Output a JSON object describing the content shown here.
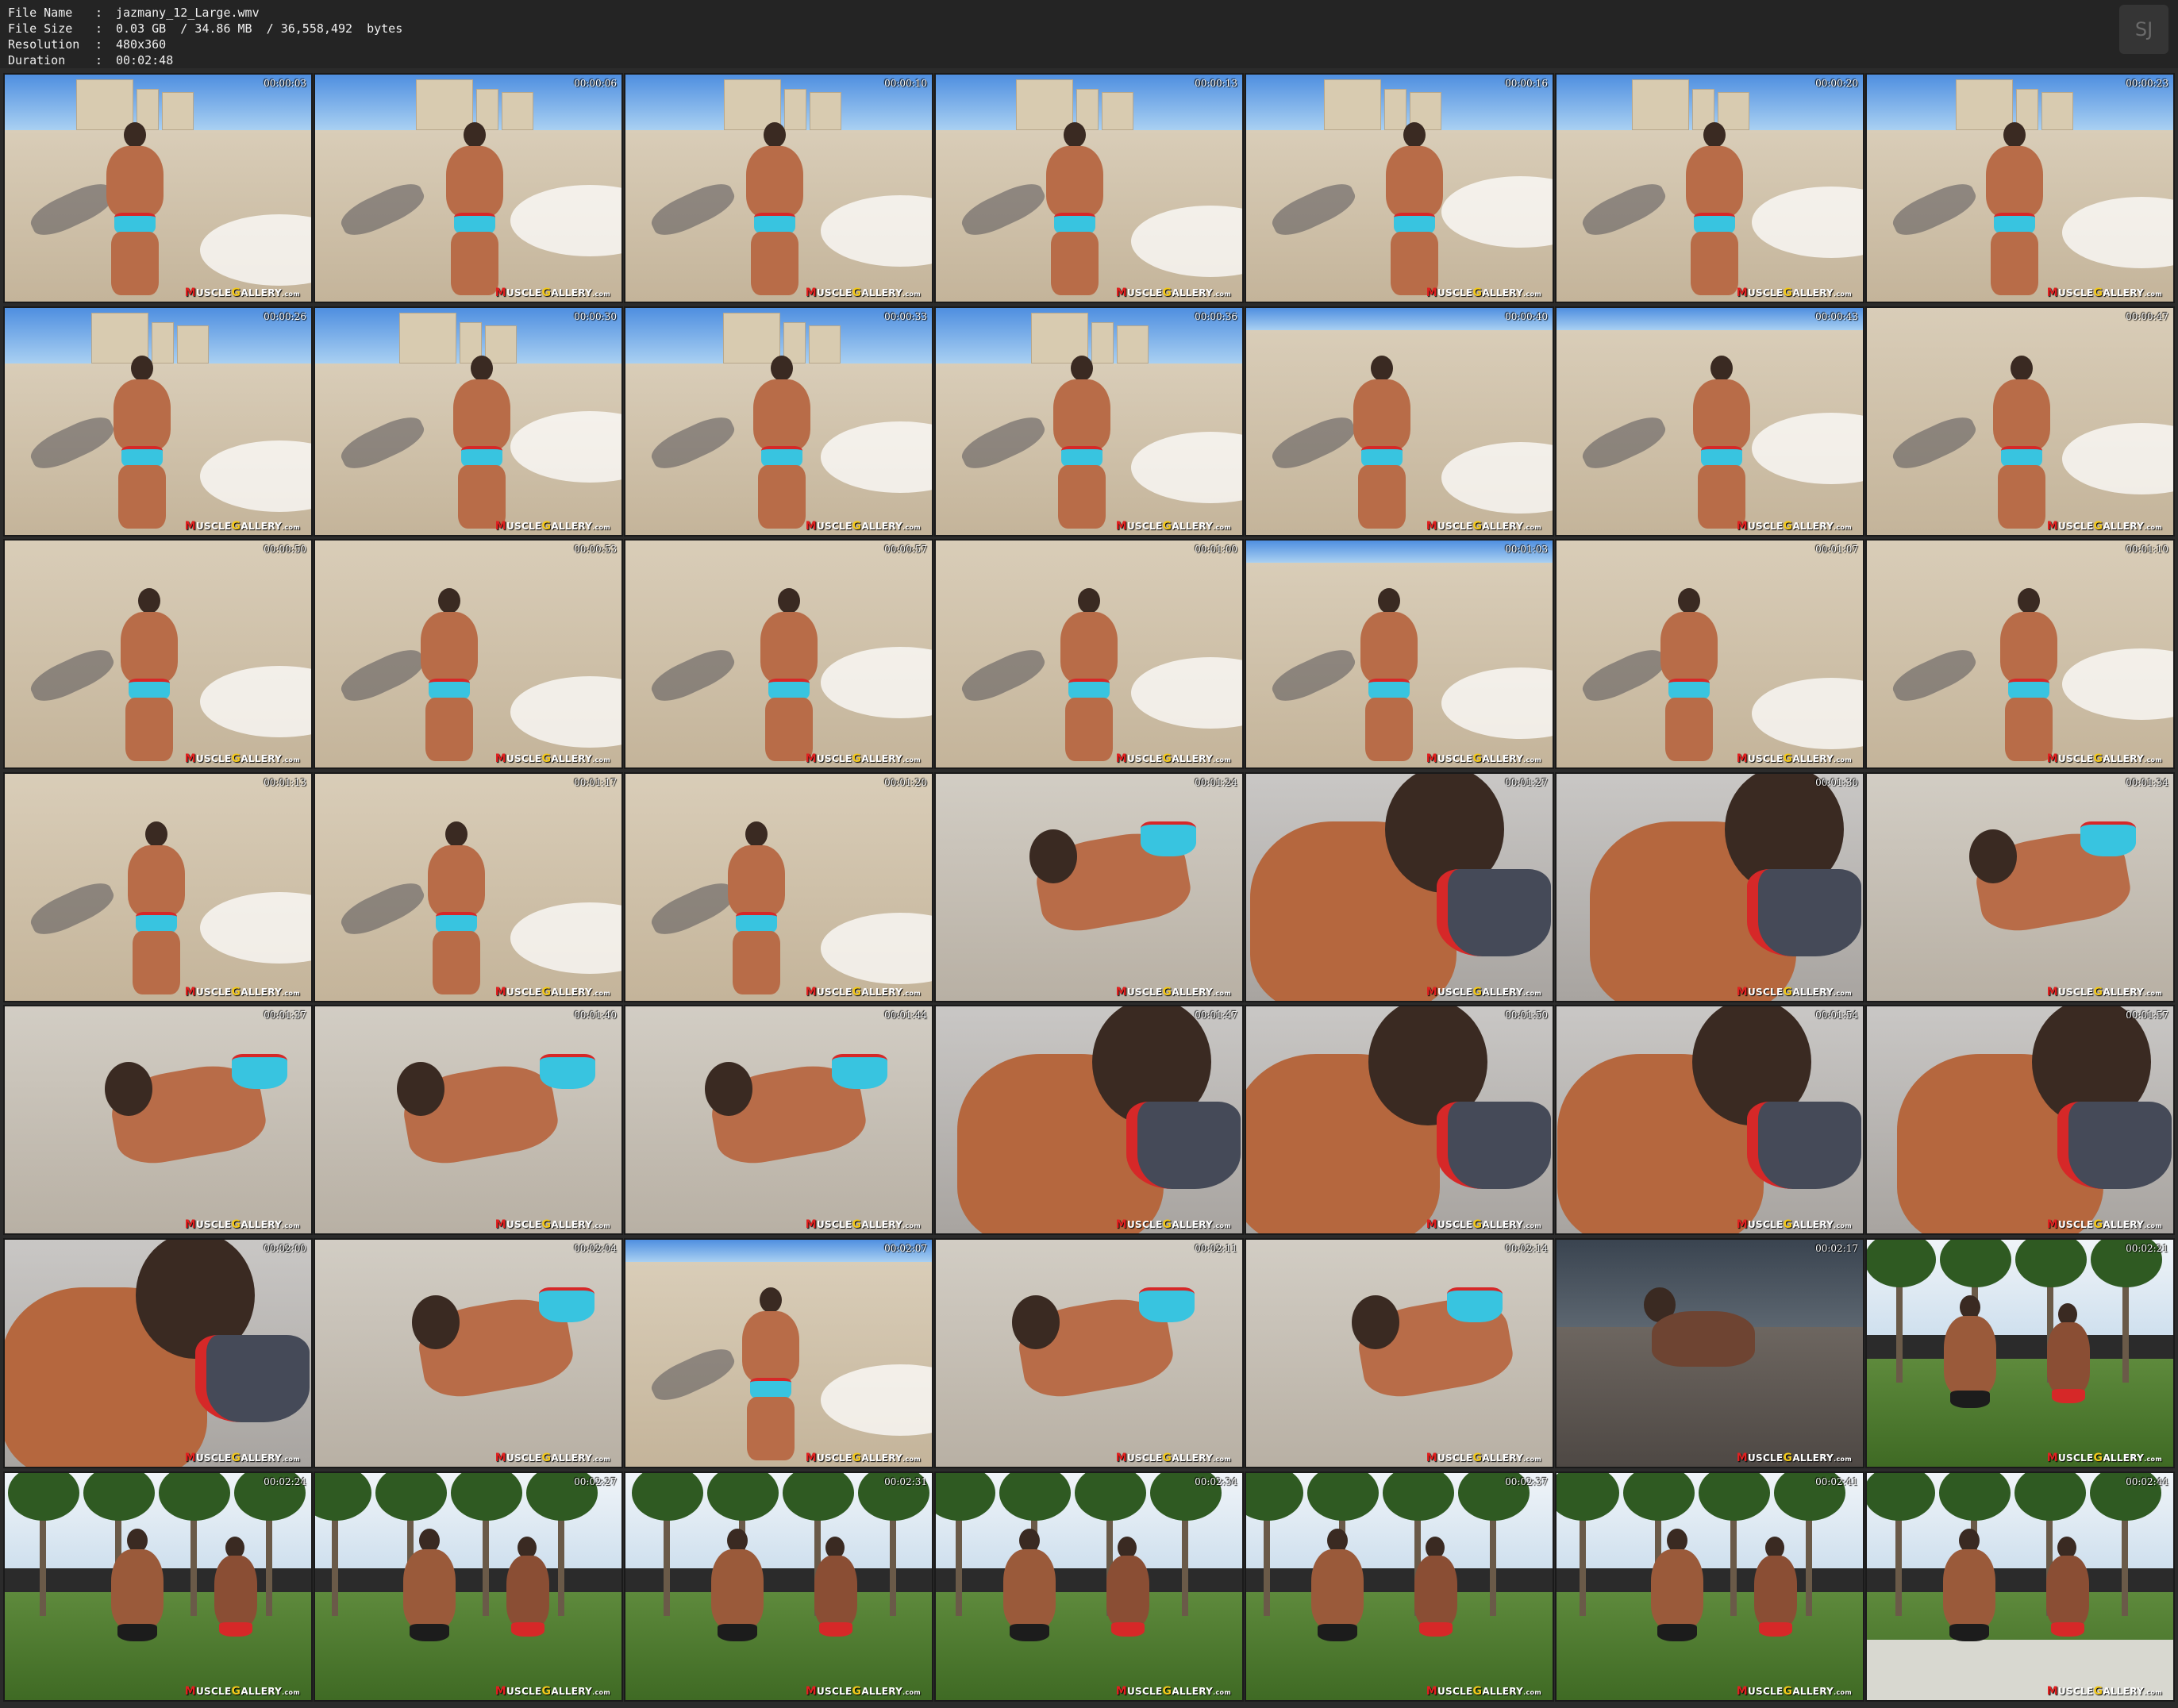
{
  "info": {
    "rows": [
      {
        "key": "File Name",
        "value": "jazmany_12_Large.wmv"
      },
      {
        "key": "File Size",
        "value": "0.03 GB  / 34.86 MB  / 36,558,492  bytes"
      },
      {
        "key": "Resolution",
        "value": "480x360"
      },
      {
        "key": "Duration",
        "value": "00:02:48"
      }
    ],
    "separator": ":"
  },
  "logo_text": "SJ",
  "watermark": {
    "m": "M",
    "uscle": "USCLE",
    "g": "G",
    "allery": "ALLERY",
    "dom": ".com"
  },
  "thumbs": [
    {
      "ts": "00:00:03",
      "scene": "beach-city"
    },
    {
      "ts": "00:00:06",
      "scene": "beach-city"
    },
    {
      "ts": "00:00:10",
      "scene": "beach-city"
    },
    {
      "ts": "00:00:13",
      "scene": "beach-city"
    },
    {
      "ts": "00:00:16",
      "scene": "beach-city"
    },
    {
      "ts": "00:00:20",
      "scene": "beach-city"
    },
    {
      "ts": "00:00:23",
      "scene": "beach-city"
    },
    {
      "ts": "00:00:26",
      "scene": "beach-city"
    },
    {
      "ts": "00:00:30",
      "scene": "beach-city"
    },
    {
      "ts": "00:00:33",
      "scene": "beach-city"
    },
    {
      "ts": "00:00:36",
      "scene": "beach-city"
    },
    {
      "ts": "00:00:40",
      "scene": "beach-water"
    },
    {
      "ts": "00:00:43",
      "scene": "beach-water"
    },
    {
      "ts": "00:00:47",
      "scene": "beach-sand"
    },
    {
      "ts": "00:00:50",
      "scene": "beach-sand"
    },
    {
      "ts": "00:00:53",
      "scene": "beach-sand"
    },
    {
      "ts": "00:00:57",
      "scene": "beach-sand"
    },
    {
      "ts": "00:01:00",
      "scene": "beach-sand"
    },
    {
      "ts": "00:01:03",
      "scene": "beach-water"
    },
    {
      "ts": "00:01:07",
      "scene": "beach-sand"
    },
    {
      "ts": "00:01:10",
      "scene": "beach-sand"
    },
    {
      "ts": "00:01:13",
      "scene": "beach-sand"
    },
    {
      "ts": "00:01:17",
      "scene": "beach-sand"
    },
    {
      "ts": "00:01:20",
      "scene": "beach-sand"
    },
    {
      "ts": "00:01:24",
      "scene": "sand-close"
    },
    {
      "ts": "00:01:27",
      "scene": "closeup"
    },
    {
      "ts": "00:01:30",
      "scene": "closeup"
    },
    {
      "ts": "00:01:34",
      "scene": "sand-close"
    },
    {
      "ts": "00:01:37",
      "scene": "sand-close"
    },
    {
      "ts": "00:01:40",
      "scene": "sand-close"
    },
    {
      "ts": "00:01:44",
      "scene": "sand-close"
    },
    {
      "ts": "00:01:47",
      "scene": "closeup"
    },
    {
      "ts": "00:01:50",
      "scene": "closeup"
    },
    {
      "ts": "00:01:54",
      "scene": "closeup"
    },
    {
      "ts": "00:01:57",
      "scene": "closeup"
    },
    {
      "ts": "00:02:00",
      "scene": "closeup"
    },
    {
      "ts": "00:02:04",
      "scene": "sand-close"
    },
    {
      "ts": "00:02:07",
      "scene": "beach-water"
    },
    {
      "ts": "00:02:11",
      "scene": "sand-close"
    },
    {
      "ts": "00:02:14",
      "scene": "sand-close"
    },
    {
      "ts": "00:02:17",
      "scene": "dusk"
    },
    {
      "ts": "00:02:21",
      "scene": "park"
    },
    {
      "ts": "00:02:24",
      "scene": "park"
    },
    {
      "ts": "00:02:27",
      "scene": "park"
    },
    {
      "ts": "00:02:31",
      "scene": "park"
    },
    {
      "ts": "00:02:34",
      "scene": "park"
    },
    {
      "ts": "00:02:37",
      "scene": "park"
    },
    {
      "ts": "00:02:41",
      "scene": "park"
    },
    {
      "ts": "00:02:44",
      "scene": "park-path"
    }
  ],
  "colors": {
    "background": "#2b2b2b",
    "header": "#242424",
    "trunks_blue": "#38c4e0",
    "trunks_red": "#d62828"
  }
}
